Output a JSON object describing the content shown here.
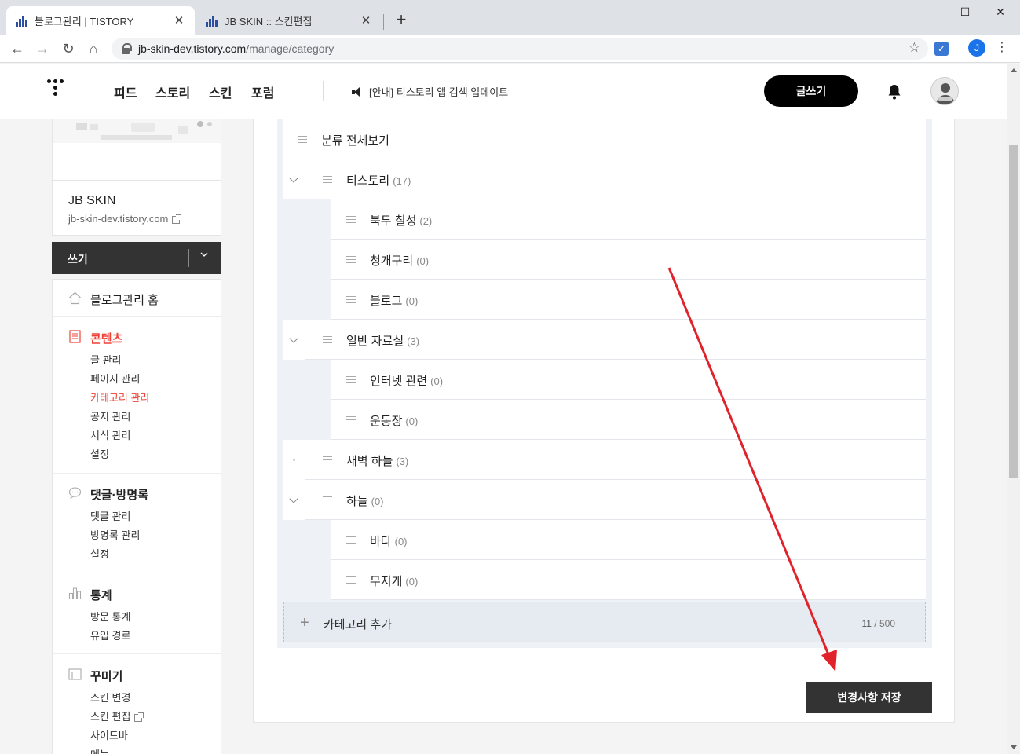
{
  "browser": {
    "tabs": [
      {
        "title": "블로그관리 | TISTORY",
        "active": true
      },
      {
        "title": "JB SKIN :: 스킨편집",
        "active": false
      }
    ],
    "new_tab": "+",
    "url_host": "jb-skin-dev.tistory.com",
    "url_path": "/manage/category",
    "profile_initial": "J",
    "window_controls": {
      "minimize": "—",
      "maximize": "☐",
      "close": "✕"
    }
  },
  "header": {
    "nav": [
      "피드",
      "스토리",
      "스킨",
      "포럼"
    ],
    "notice": "[안내] 티스토리 앱 검색 업데이트",
    "write_button": "글쓰기"
  },
  "sidebar": {
    "blog_name": "JB SKIN",
    "blog_url": "jb-skin-dev.tistory.com",
    "write_bar": "쓰기",
    "home": "블로그관리 홈",
    "groups": [
      {
        "title": "콘텐츠",
        "icon": "document-icon",
        "items": [
          "글 관리",
          "페이지 관리",
          "카테고리 관리",
          "공지 관리",
          "서식 관리",
          "설정"
        ]
      },
      {
        "title": "댓글·방명록",
        "icon": "comment-icon",
        "items": [
          "댓글 관리",
          "방명록 관리",
          "설정"
        ]
      },
      {
        "title": "통계",
        "icon": "chart-icon",
        "items": [
          "방문 통계",
          "유입 경로"
        ]
      },
      {
        "title": "꾸미기",
        "icon": "layout-icon",
        "items": [
          "스킨 변경",
          "스킨 편집",
          "사이드바",
          "메뉴"
        ]
      }
    ]
  },
  "categories": {
    "all": "분류 전체보기",
    "rows": [
      {
        "name": "티스토리",
        "count": "(17)",
        "level": 1,
        "fold": "open"
      },
      {
        "name": "북두 칠성",
        "count": "(2)",
        "level": 2
      },
      {
        "name": "청개구리",
        "count": "(0)",
        "level": 2
      },
      {
        "name": "블로그",
        "count": "(0)",
        "level": 2
      },
      {
        "name": "일반 자료실",
        "count": "(3)",
        "level": 1,
        "fold": "open"
      },
      {
        "name": "인터넷 관련",
        "count": "(0)",
        "level": 2
      },
      {
        "name": "운동장",
        "count": "(0)",
        "level": 2
      },
      {
        "name": "새벽 하늘",
        "count": "(3)",
        "level": 1,
        "fold": "none"
      },
      {
        "name": "하늘",
        "count": "(0)",
        "level": 1,
        "fold": "open"
      },
      {
        "name": "바다",
        "count": "(0)",
        "level": 2
      },
      {
        "name": "무지개",
        "count": "(0)",
        "level": 2
      }
    ],
    "add_label": "카테고리 추가",
    "count_current": "11",
    "count_max": "/ 500"
  },
  "save_button": "변경사항 저장",
  "colors": {
    "accent_red": "#ef4136",
    "annotation_arrow": "#e0232b",
    "dark_button": "#333333"
  }
}
